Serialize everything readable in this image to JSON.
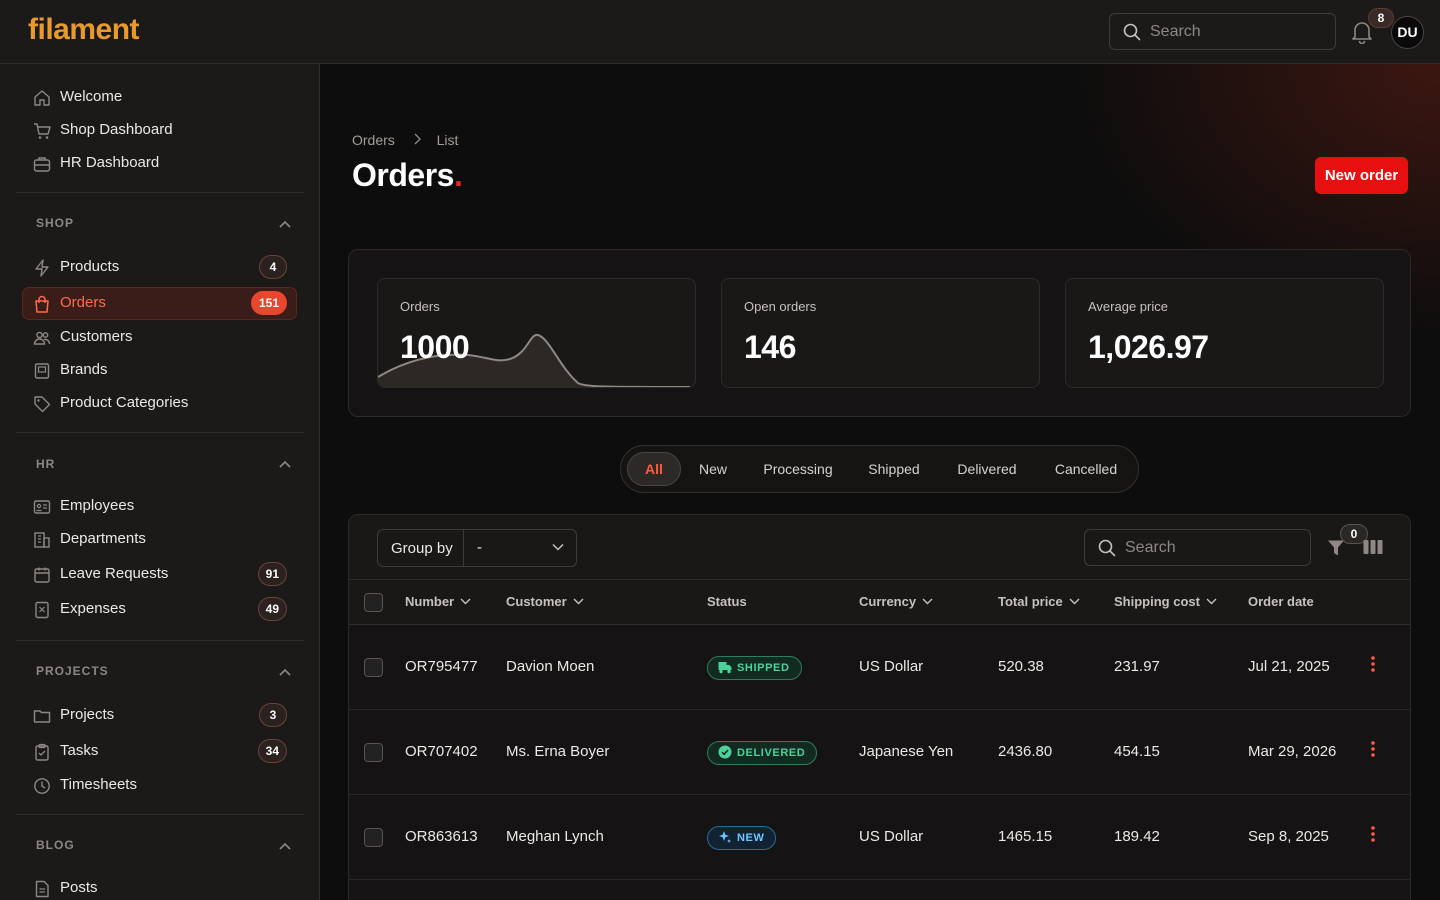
{
  "app": {
    "logo": "filament"
  },
  "header": {
    "search_placeholder": "Search",
    "notifications_count": "8",
    "avatar_initials": "DU"
  },
  "sidebar": {
    "top_items": [
      {
        "label": "Welcome",
        "icon": "home-icon"
      },
      {
        "label": "Shop Dashboard",
        "icon": "cart-icon"
      },
      {
        "label": "HR Dashboard",
        "icon": "briefcase-icon"
      }
    ],
    "groups": [
      {
        "title": "SHOP",
        "items": [
          {
            "label": "Products",
            "badge": "4"
          },
          {
            "label": "Orders",
            "badge": "151",
            "active": true
          },
          {
            "label": "Customers",
            "badge": ""
          },
          {
            "label": "Brands",
            "badge": ""
          },
          {
            "label": "Product Categories",
            "badge": ""
          }
        ]
      },
      {
        "title": "HR",
        "items": [
          {
            "label": "Employees",
            "badge": ""
          },
          {
            "label": "Departments",
            "badge": ""
          },
          {
            "label": "Leave Requests",
            "badge": "91"
          },
          {
            "label": "Expenses",
            "badge": "49"
          }
        ]
      },
      {
        "title": "PROJECTS",
        "items": [
          {
            "label": "Projects",
            "badge": "3"
          },
          {
            "label": "Tasks",
            "badge": "34"
          },
          {
            "label": "Timesheets",
            "badge": ""
          }
        ]
      },
      {
        "title": "BLOG",
        "items": [
          {
            "label": "Posts",
            "badge": ""
          }
        ]
      }
    ]
  },
  "page": {
    "breadcrumb": [
      "Orders",
      "List"
    ],
    "title": "Orders",
    "title_dot": ".",
    "new_order_label": "New order"
  },
  "stats": [
    {
      "label": "Orders",
      "value": "1000"
    },
    {
      "label": "Open orders",
      "value": "146"
    },
    {
      "label": "Average price",
      "value": "1,026.97"
    }
  ],
  "tabs": [
    "All",
    "New",
    "Processing",
    "Shipped",
    "Delivered",
    "Cancelled"
  ],
  "active_tab": "All",
  "table": {
    "group_by_label": "Group by",
    "group_by_value": "-",
    "search_placeholder": "Search",
    "filter_count": "0",
    "columns": [
      "Number",
      "Customer",
      "Status",
      "Currency",
      "Total price",
      "Shipping cost",
      "Order date"
    ],
    "rows": [
      {
        "number": "OR795477",
        "customer": "Davion Moen",
        "status": "SHIPPED",
        "currency": "US Dollar",
        "total": "520.38",
        "shipping": "231.97",
        "date": "Jul 21, 2025"
      },
      {
        "number": "OR707402",
        "customer": "Ms. Erna Boyer",
        "status": "DELIVERED",
        "currency": "Japanese Yen",
        "total": "2436.80",
        "shipping": "454.15",
        "date": "Mar 29, 2026"
      },
      {
        "number": "OR863613",
        "customer": "Meghan Lynch",
        "status": "NEW",
        "currency": "US Dollar",
        "total": "1465.15",
        "shipping": "189.42",
        "date": "Sep 8, 2025"
      }
    ]
  },
  "colors": {
    "accent": "#e8462e",
    "primary_button": "#e70f0f",
    "logo": "#e99a2b",
    "success": "#4ad39a",
    "info": "#6ec6ff"
  }
}
